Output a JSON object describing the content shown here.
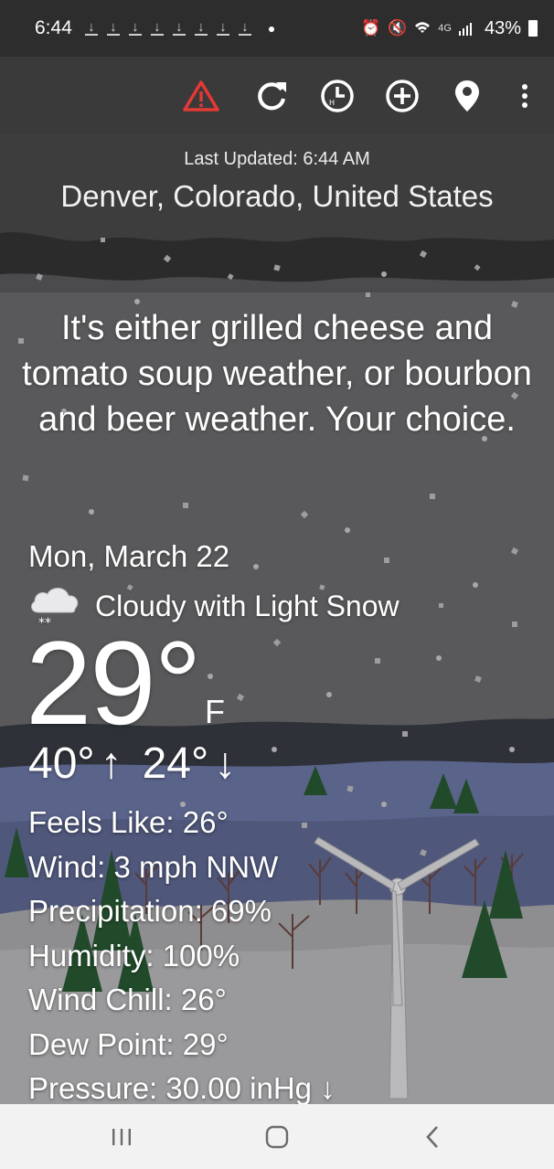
{
  "status_bar": {
    "time": "6:44",
    "network": "4G",
    "battery": "43%"
  },
  "toolbar": {
    "icons": [
      "alert-icon",
      "refresh-icon",
      "history-clock-icon",
      "add-location-icon",
      "location-pin-icon",
      "more-vert-icon"
    ],
    "alert_color": "#e53935"
  },
  "header": {
    "last_updated": "Last Updated: 6:44 AM",
    "location": "Denver, Colorado, United States"
  },
  "quip": "It's either grilled cheese and tomato soup weather, or bourbon and beer weather. Your choice.",
  "current": {
    "date": "Mon, March 22",
    "condition": "Cloudy with Light Snow",
    "temperature": "29°",
    "unit": "F",
    "high": "40°",
    "low": "24°"
  },
  "details": [
    "Feels Like: 26°",
    "Wind: 3 mph NNW",
    "Precipitation: 69%",
    "Humidity: 100%",
    "Wind Chill: 26°",
    "Dew Point: 29°",
    "Pressure: 30.00 inHg ↓"
  ],
  "nav": [
    "recent-apps-icon",
    "home-icon",
    "back-icon"
  ]
}
